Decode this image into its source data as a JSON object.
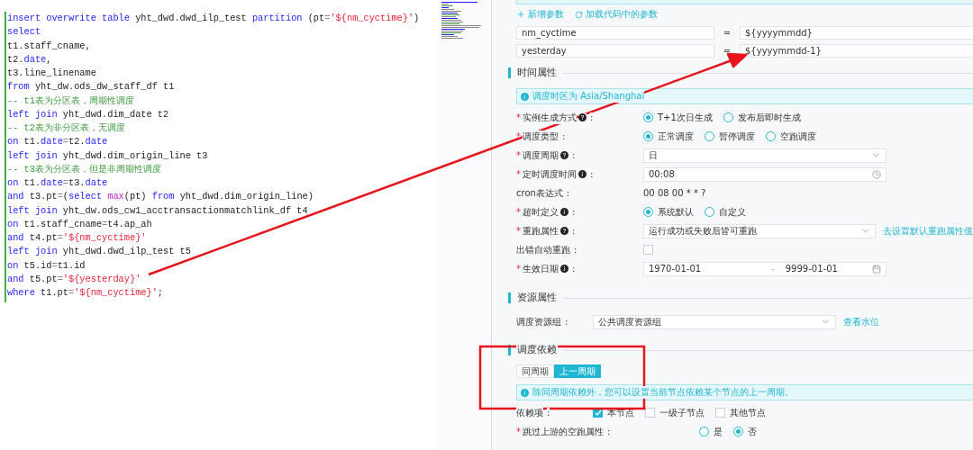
{
  "editor": {
    "lines": [
      [
        {
          "kind": "kw",
          "text": "insert overwrite table "
        },
        {
          "kind": "id",
          "text": "yht_dwd.dwd_ilp_test "
        },
        {
          "kind": "kw",
          "text": "partition "
        },
        {
          "kind": "id",
          "text": "(pt"
        },
        {
          "kind": "op",
          "text": "="
        },
        {
          "kind": "str",
          "text": "'${nm_cyctime}'"
        },
        {
          "kind": "id",
          "text": ")"
        }
      ],
      [
        {
          "kind": "kw",
          "text": "select"
        }
      ],
      [
        {
          "kind": "id",
          "text": "t1.staff_cname,"
        }
      ],
      [
        {
          "kind": "id",
          "text": "t2."
        },
        {
          "kind": "kw",
          "text": "date"
        },
        {
          "kind": "id",
          "text": ","
        }
      ],
      [
        {
          "kind": "id",
          "text": "t3.line_linename"
        }
      ],
      [
        {
          "kind": "kw",
          "text": "from "
        },
        {
          "kind": "id",
          "text": "yht_dw.ods_dw_staff_df t1"
        }
      ],
      [
        {
          "kind": "cm",
          "text": "-- t1表为分区表，周期性调度"
        }
      ],
      [
        {
          "kind": "kw",
          "text": "left join "
        },
        {
          "kind": "id",
          "text": "yht_dwd.dim_date t2"
        }
      ],
      [
        {
          "kind": "cm",
          "text": "-- t2表为非分区表，无调度"
        }
      ],
      [
        {
          "kind": "kw",
          "text": "on "
        },
        {
          "kind": "id",
          "text": "t1."
        },
        {
          "kind": "kw",
          "text": "date"
        },
        {
          "kind": "op",
          "text": "="
        },
        {
          "kind": "id",
          "text": "t2."
        },
        {
          "kind": "kw",
          "text": "date"
        }
      ],
      [
        {
          "kind": "kw",
          "text": "left join "
        },
        {
          "kind": "id",
          "text": "yht_dwd.dim_origin_line t3"
        }
      ],
      [
        {
          "kind": "cm",
          "text": "-- t3表为分区表，但是非周期性调度"
        }
      ],
      [
        {
          "kind": "kw",
          "text": "on "
        },
        {
          "kind": "id",
          "text": "t1."
        },
        {
          "kind": "kw",
          "text": "date"
        },
        {
          "kind": "op",
          "text": "="
        },
        {
          "kind": "id",
          "text": "t3."
        },
        {
          "kind": "kw",
          "text": "date"
        }
      ],
      [
        {
          "kind": "kw",
          "text": "and "
        },
        {
          "kind": "id",
          "text": "t3.pt"
        },
        {
          "kind": "op",
          "text": "="
        },
        {
          "kind": "id",
          "text": "("
        },
        {
          "kind": "kw",
          "text": "select "
        },
        {
          "kind": "fn",
          "text": "max"
        },
        {
          "kind": "id",
          "text": "(pt) "
        },
        {
          "kind": "kw",
          "text": "from "
        },
        {
          "kind": "id",
          "text": "yht_dwd.dim_origin_line)"
        }
      ],
      [
        {
          "kind": "kw",
          "text": "left join "
        },
        {
          "kind": "id",
          "text": "yht_dw.ods_cw1_acctransactionmatchlink_df t4"
        }
      ],
      [
        {
          "kind": "kw",
          "text": "on "
        },
        {
          "kind": "id",
          "text": "t1.staff_cname"
        },
        {
          "kind": "op",
          "text": "="
        },
        {
          "kind": "id",
          "text": "t4.ap_ah"
        }
      ],
      [
        {
          "kind": "kw",
          "text": "and "
        },
        {
          "kind": "id",
          "text": "t4.pt"
        },
        {
          "kind": "op",
          "text": "="
        },
        {
          "kind": "str",
          "text": "'${nm_cyctime}'"
        }
      ],
      [
        {
          "kind": "kw",
          "text": "left join "
        },
        {
          "kind": "id",
          "text": "yht_dwd.dwd_ilp_test t5"
        }
      ],
      [
        {
          "kind": "kw",
          "text": "on "
        },
        {
          "kind": "id",
          "text": "t5.id"
        },
        {
          "kind": "op",
          "text": "="
        },
        {
          "kind": "id",
          "text": "t1.id"
        }
      ],
      [
        {
          "kind": "kw",
          "text": "and "
        },
        {
          "kind": "id",
          "text": "t5.pt"
        },
        {
          "kind": "op",
          "text": "="
        },
        {
          "kind": "str",
          "text": "'${yesterday}'"
        }
      ],
      [
        {
          "kind": "kw",
          "text": "where "
        },
        {
          "kind": "id",
          "text": "t1.pt"
        },
        {
          "kind": "op",
          "text": "="
        },
        {
          "kind": "str",
          "text": "'${nm_cyctime}'"
        },
        {
          "kind": "id",
          "text": ";"
        }
      ]
    ]
  },
  "params": {
    "actions": [
      {
        "kind": "add",
        "label": "新增参数"
      },
      {
        "kind": "reload",
        "label": "加载代码中的参数"
      }
    ],
    "rows": [
      {
        "name": "nm_cyctime",
        "sep": "=",
        "value": "${yyyymmdd}"
      },
      {
        "name": "yesterday",
        "sep": "=",
        "value": "${yyyymmdd-1}"
      }
    ]
  },
  "sections": [
    {
      "title": "时间属性",
      "notice": "调度时区为 Asia/Shanghai",
      "rows": [
        {
          "kind": "radio",
          "mark": "*",
          "label": "实例生成方式",
          "help": {
            "kind": "question"
          },
          "colon": ":",
          "options": [
            {
              "label": "T+1次日生成",
              "selected": true
            },
            {
              "label": "发布后即时生成",
              "selected": false
            }
          ]
        },
        {
          "kind": "radio",
          "mark": "*",
          "label": "调度类型",
          "colon": ":",
          "options": [
            {
              "label": "正常调度",
              "selected": true
            },
            {
              "label": "暂停调度",
              "selected": false
            },
            {
              "label": "空跑调度",
              "selected": false
            }
          ]
        },
        {
          "kind": "select",
          "mark": "*",
          "label": "调度周期",
          "help": {
            "kind": "question"
          },
          "colon": ":",
          "value": "日"
        },
        {
          "kind": "time",
          "mark": "*",
          "label": "定时调度时间",
          "help": {
            "kind": "info"
          },
          "colon": ":",
          "value": "00:08"
        },
        {
          "kind": "text",
          "label": "cron表达式",
          "colon": ":",
          "value": "00 08 00 * * ?"
        },
        {
          "kind": "radio",
          "mark": "*",
          "label": "超时定义",
          "help": {
            "kind": "info"
          },
          "colon": ":",
          "options": [
            {
              "label": "系统默认",
              "selected": true
            },
            {
              "label": "自定义",
              "selected": false
            }
          ]
        },
        {
          "kind": "select",
          "mark": "*",
          "label": "重跑属性",
          "help": {
            "kind": "question"
          },
          "colon": ":",
          "value": "运行成功或失败后皆可重跑",
          "link": "去设置默认重跑属性值"
        },
        {
          "kind": "checkbox",
          "label": "出错自动重跑",
          "colon": ":",
          "checked": false
        },
        {
          "kind": "daterange",
          "mark": "*",
          "label": "生效日期",
          "help": {
            "kind": "info"
          },
          "colon": ":",
          "start": "1970-01-01",
          "sep": "-",
          "end": "9999-01-01"
        }
      ]
    },
    {
      "title": "资源属性",
      "rows": [
        {
          "kind": "select",
          "label": "调度资源组",
          "colon": ":",
          "value": "公共调度资源组",
          "link": "查看水位"
        }
      ]
    },
    {
      "title": "调度依赖",
      "tabs": [
        {
          "label": "同周期",
          "selected": false
        },
        {
          "label": "上一周期",
          "selected": true
        }
      ],
      "notice": "除同周期依赖外，您可以设置当前节点依赖某个节点的上一周期。",
      "rows": [
        {
          "kind": "checks",
          "label": "依赖项",
          "colon": ":",
          "options": [
            {
              "label": "本节点",
              "checked": true
            },
            {
              "label": "一级子节点",
              "checked": false
            },
            {
              "label": "其他节点",
              "checked": false
            }
          ]
        },
        {
          "kind": "radio",
          "mark": "*",
          "label": "跳过上游的空跑属性",
          "colon": ":",
          "options": [
            {
              "label": "是",
              "selected": false
            },
            {
              "label": "否",
              "selected": true
            }
          ]
        }
      ]
    }
  ],
  "annotations": {
    "arrow": true,
    "highlight_box": true
  }
}
